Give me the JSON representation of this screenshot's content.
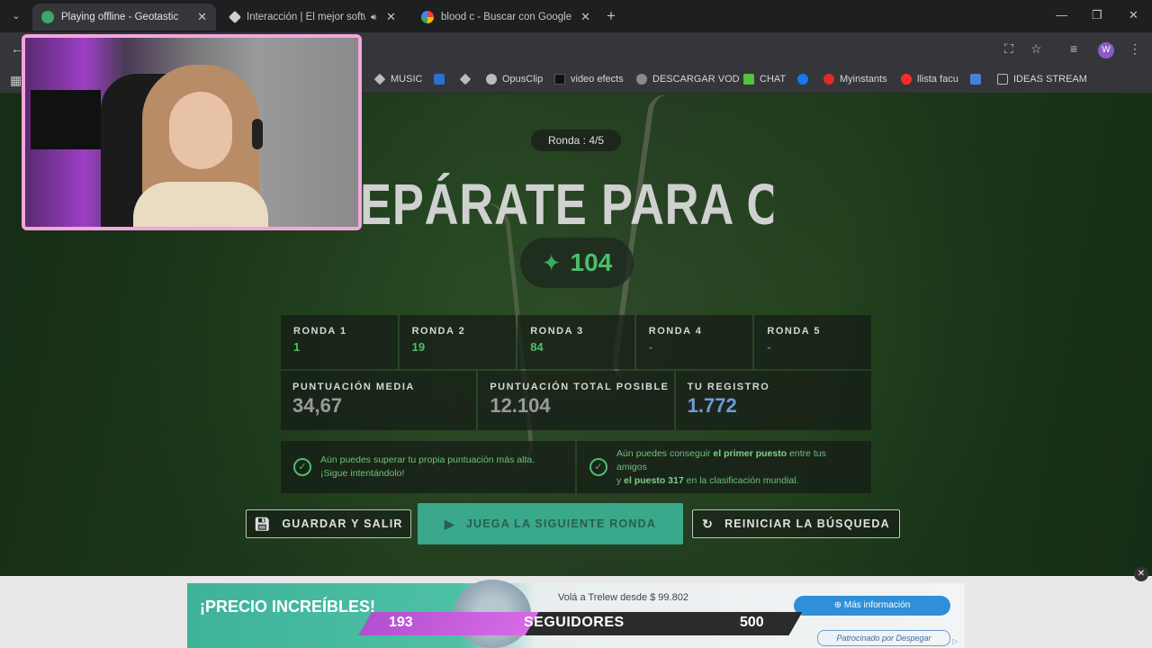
{
  "browser": {
    "tabs": [
      {
        "title": "Playing offline - Geotastic",
        "favicon_color": "#3aa86b",
        "active": true
      },
      {
        "title": "Interacción | El mejor softwa",
        "favicon_color": "#cfcfcf",
        "active": false,
        "audio": true
      },
      {
        "title": "blood c - Buscar con Google",
        "favicon_color": "#4285f4",
        "active": false
      }
    ],
    "new_tab_icon": "plus-icon",
    "window_controls": [
      "minimize-icon",
      "restore-icon",
      "close-icon"
    ],
    "profile_initial": "W",
    "bookmarks": [
      {
        "label": "MUSIC",
        "color": "#bbbbbb"
      },
      {
        "label": "",
        "color": "#2d6fd1"
      },
      {
        "label": "",
        "color": "#bbbbbb"
      },
      {
        "label": "OpusClip",
        "color": "#bbbbbb"
      },
      {
        "label": "video efects",
        "color": "#222222"
      },
      {
        "label": "DESCARGAR VOD",
        "color": "#8a8a8a"
      },
      {
        "label": "CHAT",
        "color": "#53c43a"
      },
      {
        "label": "",
        "color": "#1877f2"
      },
      {
        "label": "Myinstants",
        "color": "#e02b2b"
      },
      {
        "label": "llista facu",
        "color": "#ff2b2b"
      },
      {
        "label": "",
        "color": "#4a7fd6"
      },
      {
        "label": "IDEAS STREAM",
        "color": "#bbbbbb"
      }
    ]
  },
  "game": {
    "round_indicator": "Ronda : 4/5",
    "headline": "EPÁRATE PARA CAZAR",
    "score": "104",
    "rounds": [
      {
        "label": "RONDA 1",
        "value": "1"
      },
      {
        "label": "RONDA 2",
        "value": "19"
      },
      {
        "label": "RONDA 3",
        "value": "84"
      },
      {
        "label": "RONDA 4",
        "value": "-"
      },
      {
        "label": "RONDA 5",
        "value": "-"
      }
    ],
    "stats": [
      {
        "label": "PUNTUACIÓN MEDIA",
        "value": "34,67"
      },
      {
        "label": "PUNTUACIÓN TOTAL POSIBLE",
        "value": "12.104"
      },
      {
        "label": "TU REGISTRO",
        "value": "1.772"
      }
    ],
    "info": [
      {
        "line1": "Aún puedes superar tu propia puntuación más alta.",
        "line2": "¡Sigue intentándolo!"
      },
      {
        "line1_a": "Aún puedes conseguir ",
        "line1_b": "el primer puesto",
        "line1_c": " entre tus amigos",
        "line2_a": "y ",
        "line2_b": "el puesto 317",
        "line2_c": " en la clasificación mundial."
      }
    ],
    "buttons": {
      "save": "GUARDAR Y SALIR",
      "next": "JUEGA LA SIGUIENTE RONDA",
      "restart": "REINICIAR LA BÚSQUEDA"
    }
  },
  "ad": {
    "headline": "¡PRECIO INCREÍBLES!",
    "offer": "Volá a Trelew desde $ 99.802",
    "more_info": "⊕ Más información",
    "sponsor": "Patrocinado por Despegar"
  },
  "followers": {
    "current": "193",
    "label": "SEGUIDORES",
    "goal": "500",
    "progress": 0.386
  }
}
